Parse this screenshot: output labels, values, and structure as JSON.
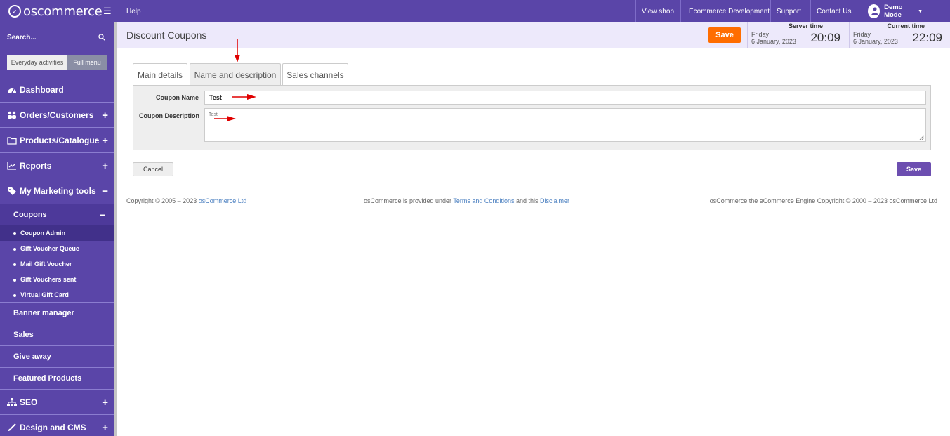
{
  "brand": {
    "logo_text": "oscommerce"
  },
  "sidebar": {
    "search_placeholder": "Search...",
    "toggle": {
      "everyday": "Everyday activities",
      "full": "Full menu"
    },
    "items": [
      {
        "label": "Dashboard",
        "icon": "dashboard-icon"
      },
      {
        "label": "Orders/Customers",
        "icon": "users-icon"
      },
      {
        "label": "Products/Catalogue",
        "icon": "folder-icon"
      },
      {
        "label": "Reports",
        "icon": "chart-icon"
      },
      {
        "label": "My Marketing tools",
        "icon": "tag-icon"
      }
    ],
    "coupons": {
      "label": "Coupons",
      "children": [
        "Coupon Admin",
        "Gift Voucher Queue",
        "Mail Gift Voucher",
        "Gift Vouchers sent",
        "Virtual Gift Card"
      ]
    },
    "marketing_subitems": [
      "Banner manager",
      "Sales",
      "Give away",
      "Featured Products"
    ],
    "bottom_items": [
      {
        "label": "SEO",
        "icon": "sitemap-icon"
      },
      {
        "label": "Design and CMS",
        "icon": "brush-icon"
      }
    ]
  },
  "topbar": {
    "help": "Help",
    "links": [
      "View shop",
      "Ecommerce Development",
      "Support",
      "Contact Us"
    ],
    "user": "Demo Mode"
  },
  "header": {
    "title": "Discount Coupons",
    "save": "Save",
    "server_time": {
      "title": "Server time",
      "day": "Friday",
      "date": "6 January, 2023",
      "time": "20:09"
    },
    "current_time": {
      "title": "Current time",
      "day": "Friday",
      "date": "6 January, 2023",
      "time": "22:09"
    }
  },
  "tabs": [
    "Main details",
    "Name and description",
    "Sales channels"
  ],
  "form": {
    "name_label": "Coupon Name",
    "name_value": "Test",
    "desc_label": "Coupon Description",
    "desc_value": "Test"
  },
  "actions": {
    "cancel": "Cancel",
    "save": "Save"
  },
  "footer": {
    "left_prefix": "Copyright © 2005 – 2023 ",
    "left_link": "osCommerce Ltd",
    "mid_prefix": "osCommerce is provided under ",
    "mid_link1": "Terms and Conditions",
    "mid_sep": " and this ",
    "mid_link2": "Disclaimer",
    "right": "osCommerce the eCommerce Engine Copyright © 2000 – 2023 osCommerce Ltd"
  },
  "colors": {
    "sidebar": "#5a45a8",
    "accent_orange": "#ff6d00",
    "save_purple": "#6c4eb0",
    "annotation_arrow": "#e00000"
  }
}
